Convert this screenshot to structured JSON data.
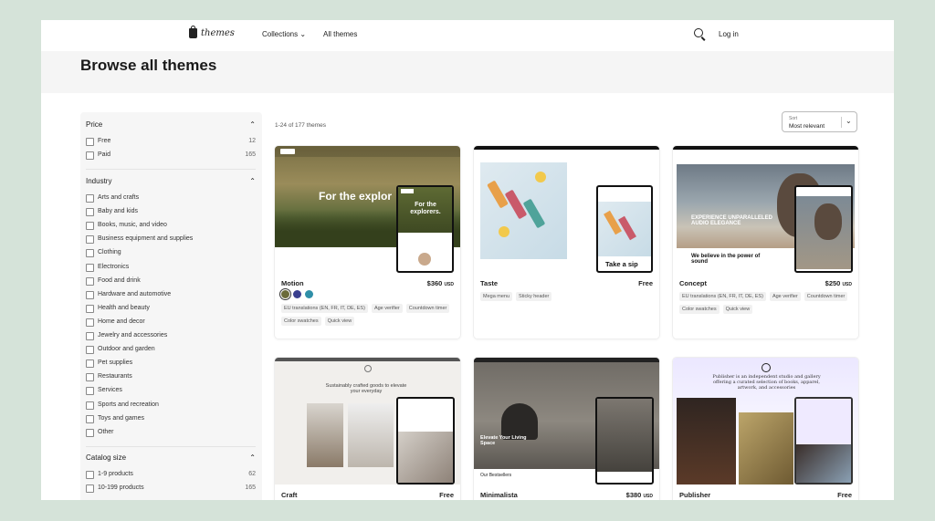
{
  "header": {
    "logo_text": "themes",
    "nav": {
      "collections": "Collections ⌄",
      "all_themes": "All themes"
    },
    "login": "Log in"
  },
  "page": {
    "title": "Browse all themes"
  },
  "filters": {
    "price": {
      "title": "Price",
      "options": [
        {
          "label": "Free",
          "count": "12"
        },
        {
          "label": "Paid",
          "count": "165"
        }
      ]
    },
    "industry": {
      "title": "Industry",
      "options": [
        {
          "label": "Arts and crafts"
        },
        {
          "label": "Baby and kids"
        },
        {
          "label": "Books, music, and video"
        },
        {
          "label": "Business equipment and supplies"
        },
        {
          "label": "Clothing"
        },
        {
          "label": "Electronics"
        },
        {
          "label": "Food and drink"
        },
        {
          "label": "Hardware and automotive"
        },
        {
          "label": "Health and beauty"
        },
        {
          "label": "Home and decor"
        },
        {
          "label": "Jewelry and accessories"
        },
        {
          "label": "Outdoor and garden"
        },
        {
          "label": "Pet supplies"
        },
        {
          "label": "Restaurants"
        },
        {
          "label": "Services"
        },
        {
          "label": "Sports and recreation"
        },
        {
          "label": "Toys and games"
        },
        {
          "label": "Other"
        }
      ]
    },
    "catalog_size": {
      "title": "Catalog size",
      "options": [
        {
          "label": "1-9 products",
          "count": "62"
        },
        {
          "label": "10-199 products",
          "count": "165"
        }
      ]
    }
  },
  "results": {
    "count_text": "1-24 of 177 themes",
    "sort": {
      "label": "Sort",
      "value": "Most relevant"
    }
  },
  "themes": [
    {
      "name": "Motion",
      "price": "$360",
      "currency": "USD",
      "swatches": [
        "#6b6b3a",
        "#3a3f8f",
        "#2f8fa8"
      ],
      "tags": [
        "EU translations (EN, FR, IT, DE, ES)",
        "Age verifier",
        "Countdown timer",
        "Color swatches",
        "Quick view"
      ],
      "preview": {
        "headline": "For the explor",
        "phone_headline": "For the explorers."
      }
    },
    {
      "name": "Taste",
      "price": "Free",
      "currency": "",
      "tags": [
        "Mega menu",
        "Sticky header"
      ],
      "preview": {
        "phone_headline": "Take a sip"
      }
    },
    {
      "name": "Concept",
      "price": "$250",
      "currency": "USD",
      "tags": [
        "EU translations (EN, FR, IT, DE, ES)",
        "Age verifier",
        "Countdown timer",
        "Color swatches",
        "Quick view"
      ],
      "preview": {
        "headline": "EXPERIENCE UNPARALLELED AUDIO ELEGANCE",
        "subheadline": "We believe in the power of sound"
      }
    },
    {
      "name": "Craft",
      "price": "Free",
      "currency": "",
      "tags": [],
      "preview": {
        "headline": "Sustainably crafted goods to elevate your everyday"
      }
    },
    {
      "name": "Minimalista",
      "price": "$380",
      "currency": "USD",
      "tags": [],
      "preview": {
        "headline": "Elevate Your Living Space",
        "footer": "Our Bestsellers"
      }
    },
    {
      "name": "Publisher",
      "price": "Free",
      "currency": "",
      "tags": [],
      "preview": {
        "headline": "Publisher is an independent studio and gallery offering a curated selection of books, apparel, artwork, and accessories"
      }
    }
  ]
}
